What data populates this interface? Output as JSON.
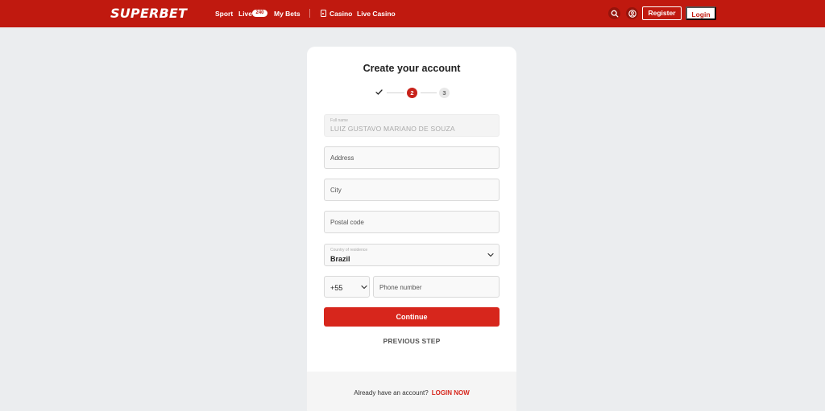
{
  "header": {
    "logo": "SUPERBET",
    "nav": {
      "sport": "Sport",
      "live": "Live",
      "live_count": "240",
      "my_bets": "My Bets",
      "casino": "Casino",
      "live_casino": "Live Casino"
    },
    "register_label": "Register",
    "login_label": "Login",
    "brand_color": "#c0190f"
  },
  "form": {
    "title": "Create your account",
    "stepper": {
      "step2": "2",
      "step3": "3"
    },
    "full_name": {
      "label": "Full name",
      "value": "LUIZ GUSTAVO MARIANO DE SOUZA"
    },
    "address": {
      "placeholder": "Address"
    },
    "city": {
      "placeholder": "City"
    },
    "postal_code": {
      "placeholder": "Postal code"
    },
    "country": {
      "label": "Country of residence",
      "value": "Brazil"
    },
    "phone": {
      "code": "+55",
      "placeholder": "Phone number"
    },
    "continue_label": "Continue",
    "previous_label": "PREVIOUS STEP",
    "footer": {
      "question": "Already have an account?",
      "login_link": "LOGIN NOW"
    },
    "accent_color": "#d7261c"
  }
}
